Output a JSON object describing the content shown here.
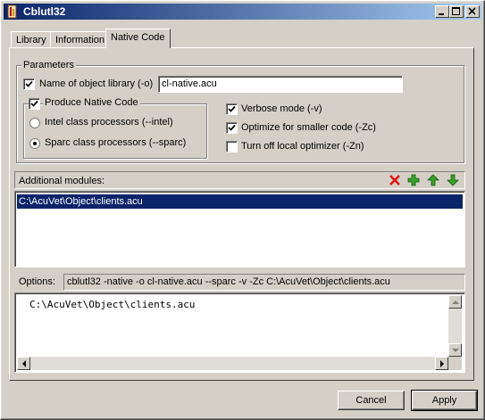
{
  "window": {
    "title": "Cblutl32"
  },
  "tabs": [
    {
      "label": "Library"
    },
    {
      "label": "Information"
    },
    {
      "label": "Native Code"
    }
  ],
  "parameters": {
    "legend": "Parameters",
    "object_library": {
      "label": "Name of object library (-o)",
      "checked": true,
      "value": "cl-native.acu"
    },
    "produce_native": {
      "label": "Produce Native Code",
      "checked": true
    },
    "intel": {
      "label": "Intel class processors (--intel)",
      "selected": false
    },
    "sparc": {
      "label": "Sparc class processors (--sparc)",
      "selected": true
    },
    "verbose": {
      "label": "Verbose mode (-v)",
      "checked": true
    },
    "optimize": {
      "label": "Optimize for smaller code (-Zc)",
      "checked": true
    },
    "local_opt": {
      "label": "Turn off local optimizer (-Zn)",
      "checked": false
    }
  },
  "modules": {
    "label": "Additional modules:",
    "items": [
      "C:\\AcuVet\\Object\\clients.acu"
    ]
  },
  "options": {
    "label": "Options:",
    "value": "cblutl32 -native -o cl-native.acu --sparc -v -Zc C:\\AcuVet\\Object\\clients.acu"
  },
  "memo": {
    "text": "C:\\AcuVet\\Object\\clients.acu"
  },
  "buttons": {
    "cancel": "Cancel",
    "apply": "Apply"
  }
}
